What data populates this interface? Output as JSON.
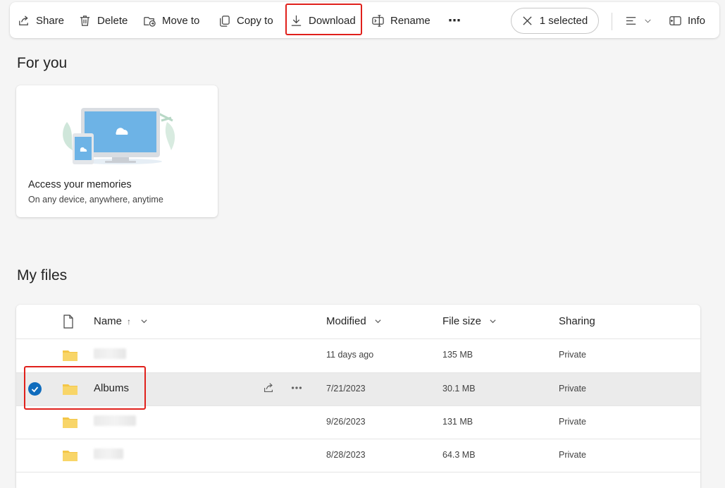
{
  "toolbar": {
    "share_label": "Share",
    "delete_label": "Delete",
    "move_to_label": "Move to",
    "copy_to_label": "Copy to",
    "download_label": "Download",
    "rename_label": "Rename",
    "more_label": "⋯",
    "selected_label": "1 selected",
    "info_label": "Info"
  },
  "for_you": {
    "heading": "For you",
    "card_title": "Access your memories",
    "card_subtitle": "On any device, anywhere, anytime"
  },
  "my_files": {
    "heading": "My files",
    "columns": {
      "name": "Name",
      "name_sort": "↑",
      "modified": "Modified",
      "file_size": "File size",
      "sharing": "Sharing"
    },
    "rows": [
      {
        "name": "",
        "modified": "11 days ago",
        "size": "135 MB",
        "sharing": "Private",
        "selected": false
      },
      {
        "name": "Albums",
        "modified": "7/21/2023",
        "size": "30.1 MB",
        "sharing": "Private",
        "selected": true
      },
      {
        "name": "",
        "modified": "9/26/2023",
        "size": "131 MB",
        "sharing": "Private",
        "selected": false
      },
      {
        "name": "",
        "modified": "8/28/2023",
        "size": "64.3 MB",
        "sharing": "Private",
        "selected": false
      }
    ]
  },
  "colors": {
    "accent": "#0f6cbd",
    "highlight": "#e0201b",
    "folder": "#f4c647"
  }
}
